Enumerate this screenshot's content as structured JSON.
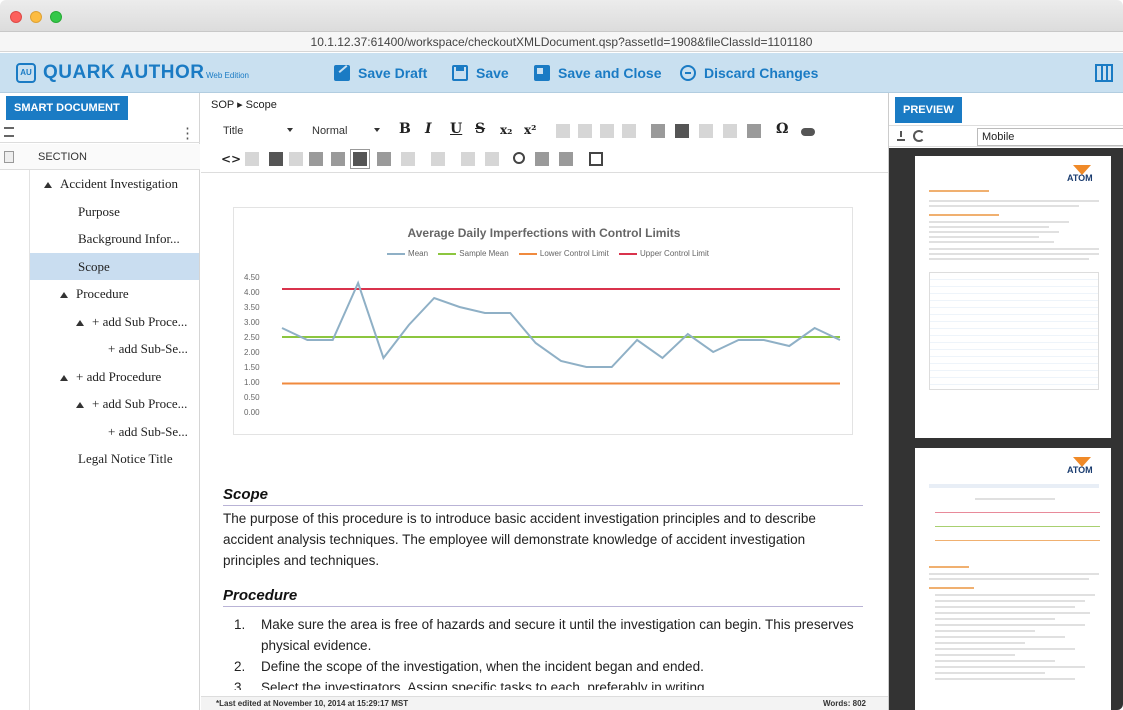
{
  "titlebar": {
    "url": "10.1.12.37:61400/workspace/checkoutXMLDocument.qsp?assetId=1908&fileClassId=1101180"
  },
  "app": {
    "logo_abbrev": "AU",
    "logo_name": "QUARK AUTHOR",
    "logo_edition": "Web Edition",
    "actions": {
      "save_draft": "Save Draft",
      "save": "Save",
      "save_close": "Save and Close",
      "discard": "Discard Changes"
    }
  },
  "sidebar": {
    "title": "SMART DOCUMENT",
    "header": "SECTION",
    "items": [
      {
        "label": "Accident Investigation"
      },
      {
        "label": "Purpose"
      },
      {
        "label": "Background Infor..."
      },
      {
        "label": "Scope"
      },
      {
        "label": "Procedure"
      },
      {
        "label": "+ add Sub Proce..."
      },
      {
        "label": "+ add Sub-Se..."
      },
      {
        "label": "+ add Procedure"
      },
      {
        "label": "+ add Sub Proce..."
      },
      {
        "label": "+ add Sub-Se..."
      },
      {
        "label": "Legal Notice Title"
      }
    ]
  },
  "editor": {
    "breadcrumb": "SOP ▸ Scope",
    "style_select": "Title",
    "para_select": "Normal",
    "toolbar": {
      "bold": "B",
      "italic": "I",
      "underline": "U",
      "strike": "S",
      "sub": "x₂",
      "sup": "x²",
      "omega": "Ω",
      "code": "<>"
    },
    "scope_heading": "Scope",
    "scope_text": "The purpose of this procedure is to introduce basic accident investigation principles and to describe accident analysis techniques. The employee will demonstrate knowledge of accident investigation principles and techniques.",
    "procedure_heading": "Procedure",
    "procedure_items": [
      {
        "num": "1.",
        "text": "Make sure the area is free of hazards and secure it until the investigation can begin. This preserves physical evidence."
      },
      {
        "num": "2.",
        "text": "Define the scope of the investigation, when the incident began and ended."
      },
      {
        "num": "3.",
        "text": "Select the investigators. Assign specific tasks to each, preferably in writing."
      }
    ],
    "status_left": "*Last edited at November 10, 2014 at 15:29:17 MST",
    "status_right": "Words: 802"
  },
  "preview": {
    "title": "PREVIEW",
    "device": "Mobile",
    "logo": "ATOM"
  },
  "chart_data": {
    "type": "line",
    "title": "Average Daily Imperfections with Control Limits",
    "y_ticks": [
      "4.50",
      "4.00",
      "3.50",
      "3.00",
      "2.50",
      "2.00",
      "1.50",
      "1.00",
      "0.50",
      "0.00"
    ],
    "ylim": [
      0,
      4.5
    ],
    "x_count": 31,
    "series": [
      {
        "name": "Mean",
        "color": "#8fb0c6",
        "values": [
          2.8,
          2.4,
          2.4,
          4.3,
          1.8,
          2.9,
          3.8,
          3.5,
          3.3,
          3.3,
          2.3,
          1.7,
          1.5,
          1.5,
          2.4,
          1.8,
          2.6,
          2.0,
          2.4,
          2.4,
          2.2,
          2.8,
          2.4
        ]
      },
      {
        "name": "Sample Mean",
        "color": "#8cc63f",
        "constant": 2.5
      },
      {
        "name": "Lower Control Limit",
        "color": "#f08a3e",
        "constant": 0.95
      },
      {
        "name": "Upper Control Limit",
        "color": "#d9334c",
        "constant": 4.1
      }
    ]
  }
}
